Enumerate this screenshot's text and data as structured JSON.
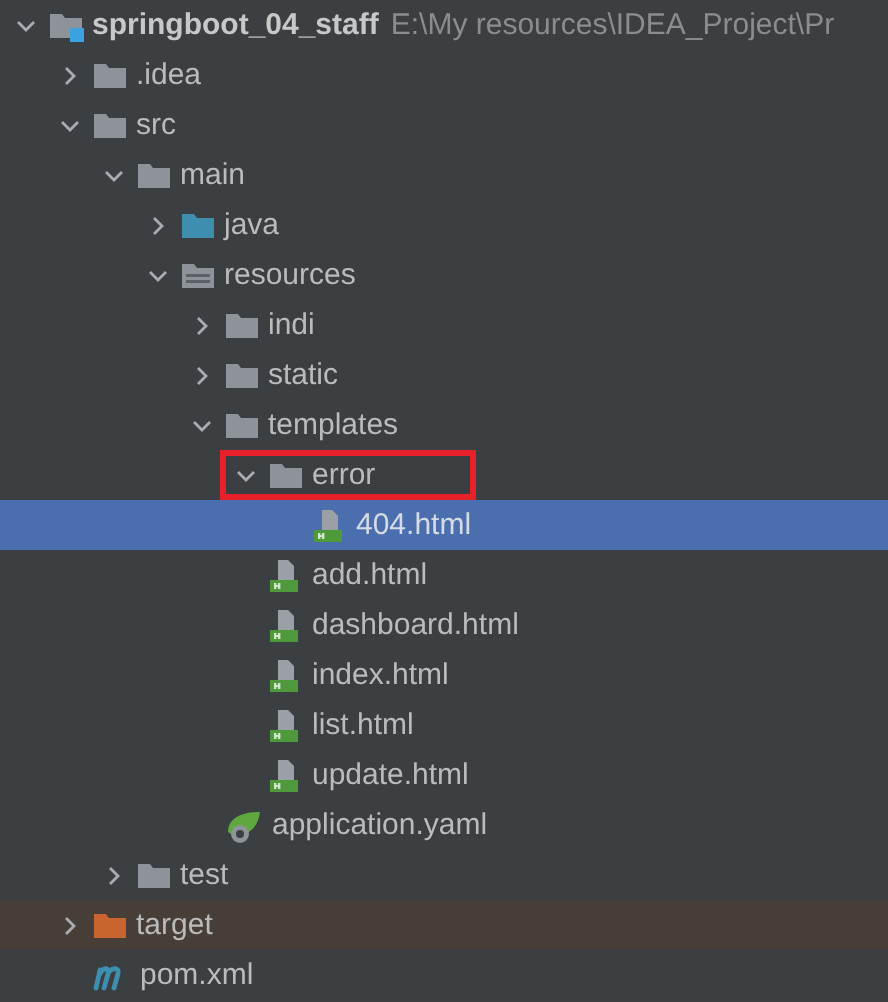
{
  "project_tree": {
    "root": {
      "name": "springboot_04_staff",
      "path": "E:\\My resources\\IDEA_Project\\Pr",
      "kind": "module",
      "expanded": true,
      "selected": false,
      "children": [
        {
          "name": ".idea",
          "kind": "folder",
          "expanded": false,
          "selected": false
        },
        {
          "name": "src",
          "kind": "folder",
          "expanded": true,
          "selected": false,
          "children": [
            {
              "name": "main",
              "kind": "folder",
              "expanded": true,
              "selected": false,
              "children": [
                {
                  "name": "java",
                  "kind": "source",
                  "expanded": false,
                  "selected": false
                },
                {
                  "name": "resources",
                  "kind": "resources",
                  "expanded": true,
                  "selected": false,
                  "children": [
                    {
                      "name": "indi",
                      "kind": "folder",
                      "expanded": false,
                      "selected": false
                    },
                    {
                      "name": "static",
                      "kind": "folder",
                      "expanded": false,
                      "selected": false
                    },
                    {
                      "name": "templates",
                      "kind": "folder",
                      "expanded": true,
                      "selected": false,
                      "children": [
                        {
                          "name": "error",
                          "kind": "folder",
                          "expanded": true,
                          "selected": false,
                          "highlighted": true,
                          "children": [
                            {
                              "name": "404.html",
                              "kind": "html",
                              "selected": true
                            }
                          ]
                        },
                        {
                          "name": "add.html",
                          "kind": "html",
                          "selected": false
                        },
                        {
                          "name": "dashboard.html",
                          "kind": "html",
                          "selected": false
                        },
                        {
                          "name": "index.html",
                          "kind": "html",
                          "selected": false
                        },
                        {
                          "name": "list.html",
                          "kind": "html",
                          "selected": false
                        },
                        {
                          "name": "update.html",
                          "kind": "html",
                          "selected": false
                        }
                      ]
                    },
                    {
                      "name": "application.yaml",
                      "kind": "yaml",
                      "selected": false
                    }
                  ]
                }
              ]
            },
            {
              "name": "test",
              "kind": "folder",
              "expanded": false,
              "selected": false
            }
          ]
        },
        {
          "name": "target",
          "kind": "excluded",
          "expanded": false,
          "selected": false
        },
        {
          "name": "pom.xml",
          "kind": "maven",
          "selected": false
        }
      ]
    }
  }
}
